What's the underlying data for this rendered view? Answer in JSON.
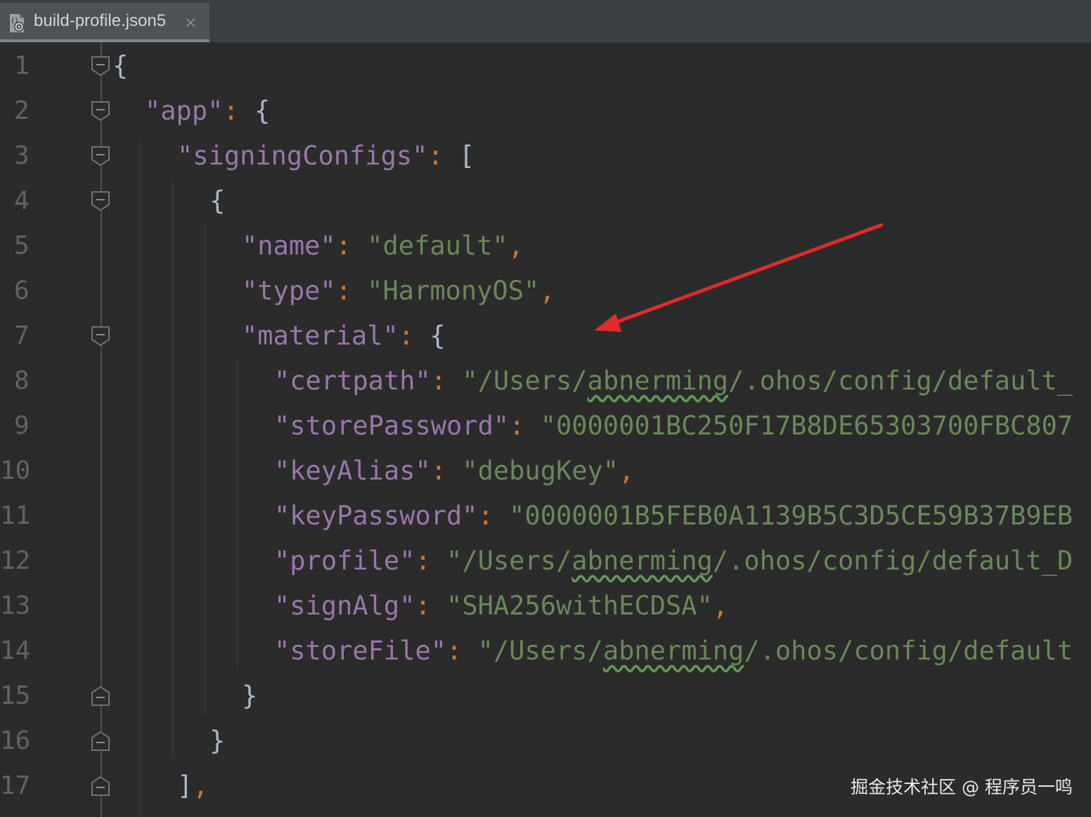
{
  "tab": {
    "title": "build-profile.json5",
    "close_icon": "×",
    "file_icon": "json-settings-icon"
  },
  "lines": [
    {
      "n": "1",
      "indent": 0
    },
    {
      "n": "2",
      "indent": 1
    },
    {
      "n": "3",
      "indent": 2
    },
    {
      "n": "4",
      "indent": 3
    },
    {
      "n": "5",
      "indent": 4
    },
    {
      "n": "6",
      "indent": 4
    },
    {
      "n": "7",
      "indent": 4
    },
    {
      "n": "8",
      "indent": 5
    },
    {
      "n": "9",
      "indent": 5
    },
    {
      "n": "10",
      "indent": 5
    },
    {
      "n": "11",
      "indent": 5
    },
    {
      "n": "12",
      "indent": 5
    },
    {
      "n": "13",
      "indent": 5
    },
    {
      "n": "14",
      "indent": 5
    },
    {
      "n": "15",
      "indent": 4
    },
    {
      "n": "16",
      "indent": 3
    },
    {
      "n": "17",
      "indent": 2
    }
  ],
  "code": {
    "l1": {
      "brace": "{"
    },
    "l2": {
      "key": "\"app\"",
      "colon": ":",
      "brace": "{"
    },
    "l3": {
      "key": "\"signingConfigs\"",
      "colon": ":",
      "brace": "["
    },
    "l4": {
      "brace": "{"
    },
    "l5": {
      "key": "\"name\"",
      "colon": ":",
      "value": "\"default\"",
      "comma": ","
    },
    "l6": {
      "key": "\"type\"",
      "colon": ":",
      "value": "\"HarmonyOS\"",
      "comma": ","
    },
    "l7": {
      "key": "\"material\"",
      "colon": ":",
      "brace": "{"
    },
    "l8": {
      "key": "\"certpath\"",
      "colon": ":",
      "v1": "\"/Users/",
      "v2": "abnerming",
      "v3": "/.ohos/config/default_"
    },
    "l9": {
      "key": "\"storePassword\"",
      "colon": ":",
      "value": "\"0000001BC250F17B8DE65303700FBC807"
    },
    "l10": {
      "key": "\"keyAlias\"",
      "colon": ":",
      "value": "\"debugKey\"",
      "comma": ","
    },
    "l11": {
      "key": "\"keyPassword\"",
      "colon": ":",
      "value": "\"0000001B5FEB0A1139B5C3D5CE59B37B9EB"
    },
    "l12": {
      "key": "\"profile\"",
      "colon": ":",
      "v1": "\"/Users/",
      "v2": "abnerming",
      "v3": "/.ohos/config/default_D"
    },
    "l13": {
      "key": "\"signAlg\"",
      "colon": ":",
      "value": "\"SHA256withECDSA\"",
      "comma": ","
    },
    "l14": {
      "key": "\"storeFile\"",
      "colon": ":",
      "v1": "\"/Users/",
      "v2": "abnerming",
      "v3": "/.ohos/config/default"
    },
    "l15": {
      "brace": "}"
    },
    "l16": {
      "brace": "}"
    },
    "l17": {
      "brace": "]",
      "comma": ","
    }
  },
  "annotation": {
    "type": "arrow",
    "color": "#e02b2b",
    "points_to": "material"
  },
  "watermark": "掘金技术社区 @ 程序员一鸣"
}
